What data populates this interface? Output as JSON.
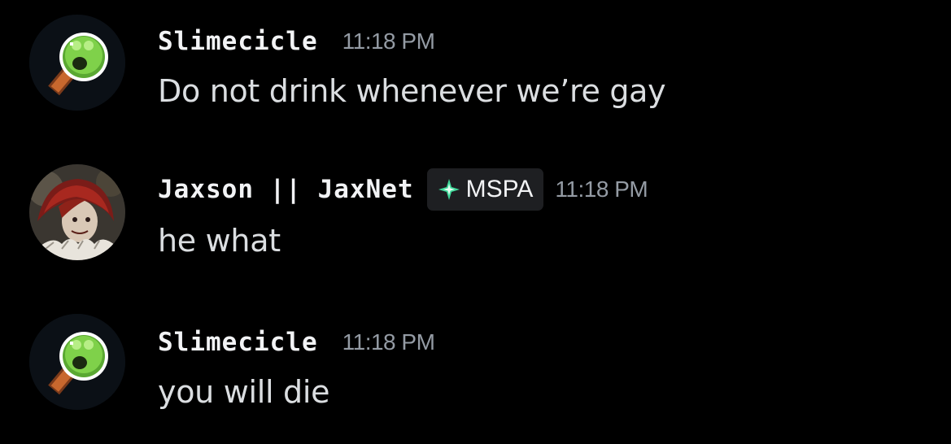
{
  "messages": [
    {
      "author": "Slimecicle",
      "timestamp": "11:18 PM",
      "content": "Do not drink whenever we’re gay",
      "avatar_icon": "slime-popsicle-icon"
    },
    {
      "author": "Jaxson || JaxNet",
      "badge": {
        "label": "MSPA",
        "icon": "sparkle-icon",
        "color": "#3fd99a"
      },
      "timestamp": "11:18 PM",
      "content": "he what",
      "avatar_icon": "red-haired-clown-avatar"
    },
    {
      "author": "Slimecicle",
      "timestamp": "11:18 PM",
      "content": "you will die",
      "avatar_icon": "slime-popsicle-icon"
    }
  ],
  "colors": {
    "background": "#000000",
    "username": "#f2f3f5",
    "timestamp": "#949ba4",
    "message_text": "#dbdee1",
    "badge_background": "#1e1f22",
    "slime_green": "#7fd14a"
  }
}
